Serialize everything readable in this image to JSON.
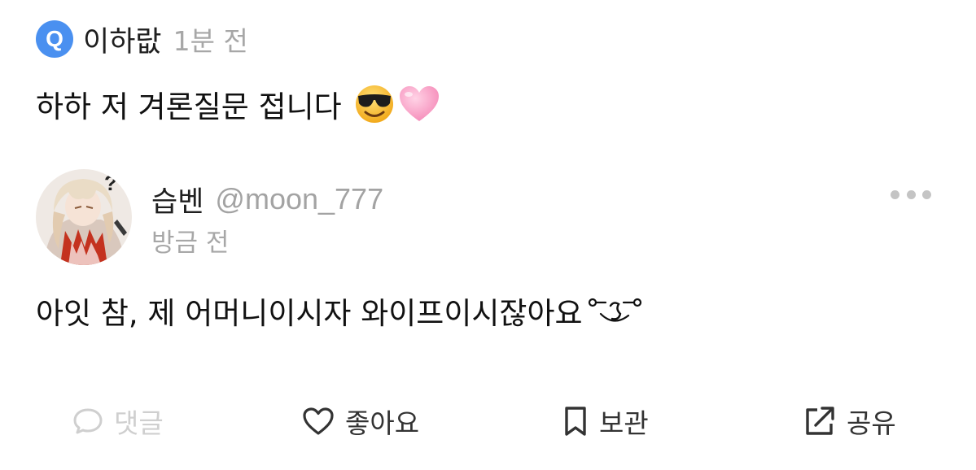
{
  "question": {
    "badge": "Q",
    "author": "이하랎",
    "time": "1분 전",
    "text": "하하 저 겨론질문 접니다",
    "emojis": [
      "sunglasses-face",
      "pink-heart"
    ]
  },
  "reply": {
    "name": "습벤",
    "handle": "@moon_777",
    "time": "방금 전",
    "text": "아잇 참, 제 어머니이시자 와이프이시잖아요",
    "kaomoji": "winking-face-kaomoji"
  },
  "actions": {
    "comment": "댓글",
    "like": "좋아요",
    "save": "보관",
    "share": "공유"
  },
  "colors": {
    "badge": "#4a90f0",
    "muted": "#a7a7a7",
    "disabled": "#cfcfcf",
    "text": "#111111"
  }
}
